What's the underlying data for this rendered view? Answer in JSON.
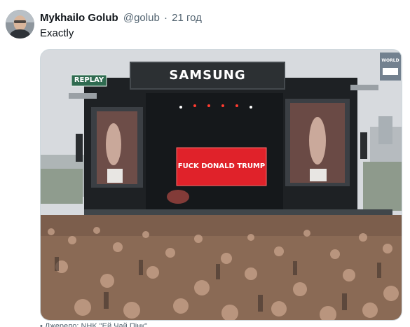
{
  "tweet": {
    "author": {
      "display_name": "Mykhailo Golub",
      "handle": "@golub",
      "avatar_icon": "user-avatar"
    },
    "separator": "·",
    "timestamp": "21 год",
    "text": "Exactly",
    "media": {
      "stage_brand": "SAMSUNG",
      "replay_badge": "REPLAY",
      "screen_message": "FUCK DONALD TRUMP",
      "corner_logo": "WORLD",
      "colors": {
        "sky": "#d7dade",
        "stage_dark": "#1e2124",
        "screen_red": "#e0222a",
        "replay_green": "#2f6b50",
        "crowd": "#8a6a55"
      }
    },
    "footer_partial": "• Джерело: NHK \"Ей Чай Пінк\""
  }
}
